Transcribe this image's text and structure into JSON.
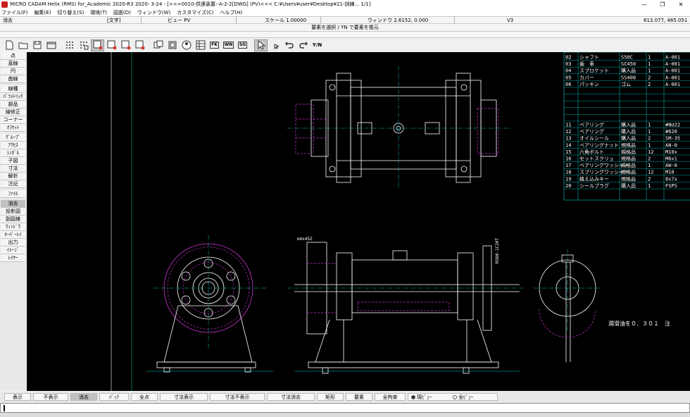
{
  "window": {
    "title": "MICRO CADAM Helix (RMS) for_Academic 2020-R3 2020- 3-24 - [>>>0010-供連装置--A-2-2[DWG] (PV)<<< C:¥Users¥user¥Desktop¥21-訓練...    1/1]",
    "minimize": "—",
    "restore": "❐",
    "close": "✕"
  },
  "menu": {
    "items": [
      "ファイル(F)",
      "編集(E)",
      "切り替え(S)",
      "環境(T)",
      "図面(D)",
      "ウィンドウ(W)",
      "カスタマイズ(C)",
      "ヘルプ(H)"
    ]
  },
  "status": {
    "mode": "消去",
    "text_mode": "[文字]",
    "view": "ビュー PV",
    "scale": "スケール 1.00000",
    "window": "ウィンドウ 2.6152, 0.000",
    "layer": "V3",
    "coords": "613.077, 465.051"
  },
  "message": "要素を選択 / YN で要素を復元",
  "toolbar": {
    "yn_label": "Y/N",
    "fk": "FK",
    "wn": "WN",
    "sg": "SG"
  },
  "sidebar": {
    "items": [
      "点",
      "直線",
      "円",
      "曲線",
      "線種",
      "ﾊﾟﾗﾒﾄﾘｯｸ",
      "部品",
      "線修正",
      "コーナー",
      "ｵﾌｾｯﾄ",
      "ｸﾞﾙｰﾌﾟ",
      "ｱｸｾｽ",
      "ｼﾝﾎﾞﾙ",
      "子図",
      "寸法",
      "解析",
      "注記",
      "ﾌｧｲﾙ",
      "消去",
      "投影図",
      "副図様",
      "ｳｨﾝﾄﾞｳ",
      "ｵｰﾊﾞｰﾚｲ",
      "出力",
      "ｲﾒｰｼﾞ",
      "ﾚｲﾔｰ"
    ]
  },
  "drawing": {
    "parts_table": [
      {
        "no": "02",
        "name": "シャフト",
        "mat": "S50C",
        "qty": "1",
        "note": "A-001"
      },
      {
        "no": "03",
        "name": "歯　車",
        "mat": "SC450",
        "qty": "1",
        "note": "A-001"
      },
      {
        "no": "04",
        "name": "スプロケット",
        "mat": "購入品",
        "qty": "1",
        "note": "A-001"
      },
      {
        "no": "05",
        "name": "カバー",
        "mat": "SS400",
        "qty": "2",
        "note": "A-001"
      },
      {
        "no": "06",
        "name": "パッキン",
        "mat": "ゴム",
        "qty": "2",
        "note": "A-001"
      },
      {
        "no": "11",
        "name": "ベアリング",
        "mat": "購入品",
        "qty": "1",
        "note": "#NU22"
      },
      {
        "no": "12",
        "name": "ベアリング",
        "mat": "購入品",
        "qty": "1",
        "note": "#620"
      },
      {
        "no": "13",
        "name": "オイルシール",
        "mat": "購入品",
        "qty": "2",
        "note": "SM-35"
      },
      {
        "no": "14",
        "name": "ベアリングナット",
        "mat": "規格品",
        "qty": "1",
        "note": "AN-0"
      },
      {
        "no": "15",
        "name": "六角ボルト",
        "mat": "規格品",
        "qty": "12",
        "note": "M10x"
      },
      {
        "no": "16",
        "name": "セットスクリュ",
        "mat": "規格品",
        "qty": "2",
        "note": "M6x1"
      },
      {
        "no": "17",
        "name": "ベアリングワッシャー",
        "mat": "規格品",
        "qty": "1",
        "note": "AW-0"
      },
      {
        "no": "18",
        "name": "スプリングワッシャー",
        "mat": "規格品",
        "qty": "12",
        "note": "M10"
      },
      {
        "no": "19",
        "name": "植え込みキー",
        "mat": "規格品",
        "qty": "2",
        "note": "8x7x"
      },
      {
        "no": "20",
        "name": "シールプラグ",
        "mat": "購入品",
        "qty": "1",
        "note": "FSPS"
      }
    ],
    "note_text": "潤滑油を０．３０１　注",
    "dim_label1": "m4x45Z",
    "dim_label2": "RS60-1C20T"
  },
  "bottom": {
    "buttons": [
      "表示",
      "不表示",
      "消去",
      "ﾊﾞｯｸ",
      "全点",
      "寸法表示",
      "寸法不表示",
      "寸法消去",
      "矩形",
      "要素",
      "全拘束"
    ],
    "radio_current": "現ﾋﾞｭｰ",
    "radio_all": "全ﾋﾞｭｰ"
  },
  "colors": {
    "canvas_bg": "#000000",
    "geometry": "#ffffff",
    "hidden": "#cc33cc",
    "center": "#00cccc",
    "table": "#00cccc"
  }
}
